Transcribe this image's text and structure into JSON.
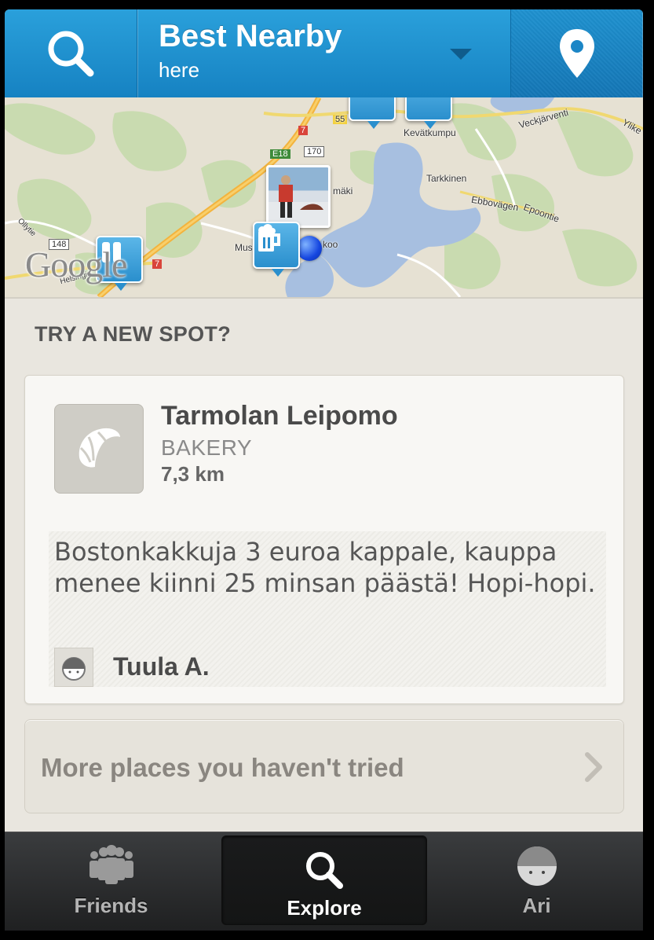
{
  "header": {
    "title": "Best Nearby",
    "subtitle": "here",
    "search_icon": "search-icon",
    "location_icon": "location-pin-icon",
    "dropdown_icon": "chevron-down-icon"
  },
  "map": {
    "attribution": "Google",
    "labels": {
      "kevatkumpu": "Kevätkumpu",
      "tarkkinen": "Tarkkinen",
      "ebbovagen": "Ebbovägen",
      "epoontie": "Epoontie",
      "maki": "mäki",
      "koo": "koo",
      "mus": "Mus",
      "veckjarvent": "Veckjärventi",
      "yliker": "Ylike",
      "olly": "Ollytie",
      "helsing": "Helsingin",
      "r55": "55",
      "r170": "170",
      "r7": "7",
      "e18": "E18",
      "r148": "148",
      "r7b": "7"
    },
    "markers": [
      "beer-mug-icon",
      "utensils-icon",
      "photo-marker",
      "current-location-dot"
    ]
  },
  "spotlight": {
    "section_title": "TRY A NEW SPOT?",
    "venue_name": "Tarmolan Leipomo",
    "venue_category": "BAKERY",
    "venue_distance": "7,3 km",
    "venue_icon": "croissant-icon",
    "tip_text": "Bostonkakkuja 3 euroa kappale, kauppa menee kiinni 25 minsan päästä! Hopi-hopi.",
    "tip_author": "Tuula A."
  },
  "more_button": {
    "label": "More places you haven't tried",
    "icon": "chevron-right-icon"
  },
  "tabbar": {
    "tabs": [
      {
        "label": "Friends",
        "icon": "friends-icon"
      },
      {
        "label": "Explore",
        "icon": "search-icon",
        "selected": true
      },
      {
        "label": "Ari",
        "icon": "avatar-icon"
      }
    ]
  },
  "colors": {
    "header_blue": "#1e90d0",
    "text_dark": "#4a4a4a",
    "background": "#e9e6df"
  }
}
